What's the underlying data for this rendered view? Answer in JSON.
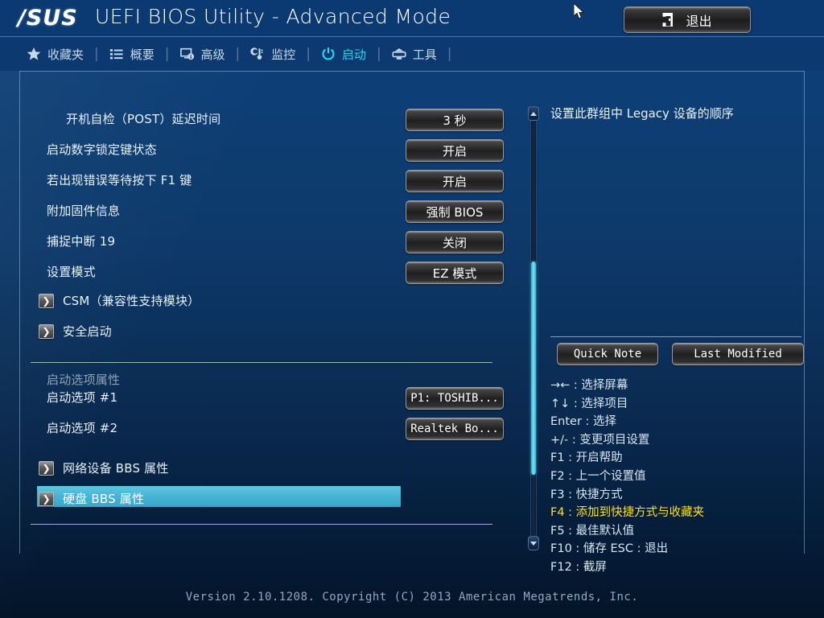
{
  "titlebar": {
    "logo": "/SUS",
    "title": "UEFI BIOS Utility - Advanced Mode",
    "exit_label": "退出",
    "exit_icon": "door-exit-icon"
  },
  "tabs": [
    {
      "label": "收藏夹",
      "icon": "star-icon",
      "active": false
    },
    {
      "label": "概要",
      "icon": "list-icon",
      "active": false
    },
    {
      "label": "高级",
      "icon": "monitor-info-icon",
      "active": false
    },
    {
      "label": "监控",
      "icon": "thermometer-icon",
      "active": false
    },
    {
      "label": "启动",
      "icon": "power-icon",
      "active": true
    },
    {
      "label": "工具",
      "icon": "printer-icon",
      "active": false
    }
  ],
  "settings": [
    {
      "label": "开机自检（POST）延迟时间",
      "value": "3 秒",
      "indent": true,
      "type": "option"
    },
    {
      "label": "启动数字锁定键状态",
      "value": "开启",
      "indent": false,
      "type": "option"
    },
    {
      "label": "若出现错误等待按下 F1 键",
      "value": "开启",
      "indent": false,
      "type": "option"
    },
    {
      "label": "附加固件信息",
      "value": "强制 BIOS",
      "indent": false,
      "type": "option"
    },
    {
      "label": "捕捉中断 19",
      "value": "关闭",
      "indent": false,
      "type": "option"
    },
    {
      "label": "设置模式",
      "value": "EZ 模式",
      "indent": false,
      "type": "option"
    },
    {
      "label": "CSM（兼容性支持模块）",
      "value": "",
      "indent": false,
      "type": "submenu"
    },
    {
      "label": "安全启动",
      "value": "",
      "indent": false,
      "type": "submenu"
    }
  ],
  "boot_section": {
    "header": "启动选项属性",
    "items": [
      {
        "label": "启动选项 #1",
        "value": "P1: TOSHIB...",
        "type": "option"
      },
      {
        "label": "启动选项 #2",
        "value": "Realtek Bo...",
        "type": "option"
      }
    ],
    "submenus": [
      {
        "label": "网络设备 BBS 属性",
        "selected": false,
        "type": "submenu"
      },
      {
        "label": "硬盘 BBS 属性",
        "selected": true,
        "type": "submenu"
      }
    ]
  },
  "help": {
    "text": "设置此群组中 Legacy 设备的顺序",
    "quick_note_label": "Quick Note",
    "last_modified_label": "Last Modified",
    "key_hints": [
      {
        "text": "→← : 选择屏幕",
        "highlight": false
      },
      {
        "text": "↑↓ : 选择项目",
        "highlight": false
      },
      {
        "text": "Enter : 选择",
        "highlight": false
      },
      {
        "text": "+/- : 变更项目设置",
        "highlight": false
      },
      {
        "text": "F1 : 开启帮助",
        "highlight": false
      },
      {
        "text": "F2 : 上一个设置值",
        "highlight": false
      },
      {
        "text": "F3 : 快捷方式",
        "highlight": false
      },
      {
        "text": "F4 : 添加到快捷方式与收藏夹",
        "highlight": true
      },
      {
        "text": "F5 : 最佳默认值",
        "highlight": false
      },
      {
        "text": "F10 : 储存  ESC : 退出",
        "highlight": false
      },
      {
        "text": "F12 : 截屏",
        "highlight": false
      }
    ]
  },
  "footer": {
    "version": "Version 2.10.1208. Copyright (C) 2013 American Megatrends, Inc."
  },
  "colors": {
    "accent_cyan": "#2ed2f0",
    "highlight_row": "#46b4d6",
    "hint_highlight": "#ffe01b",
    "panel_bg": "#0d3a6b"
  }
}
